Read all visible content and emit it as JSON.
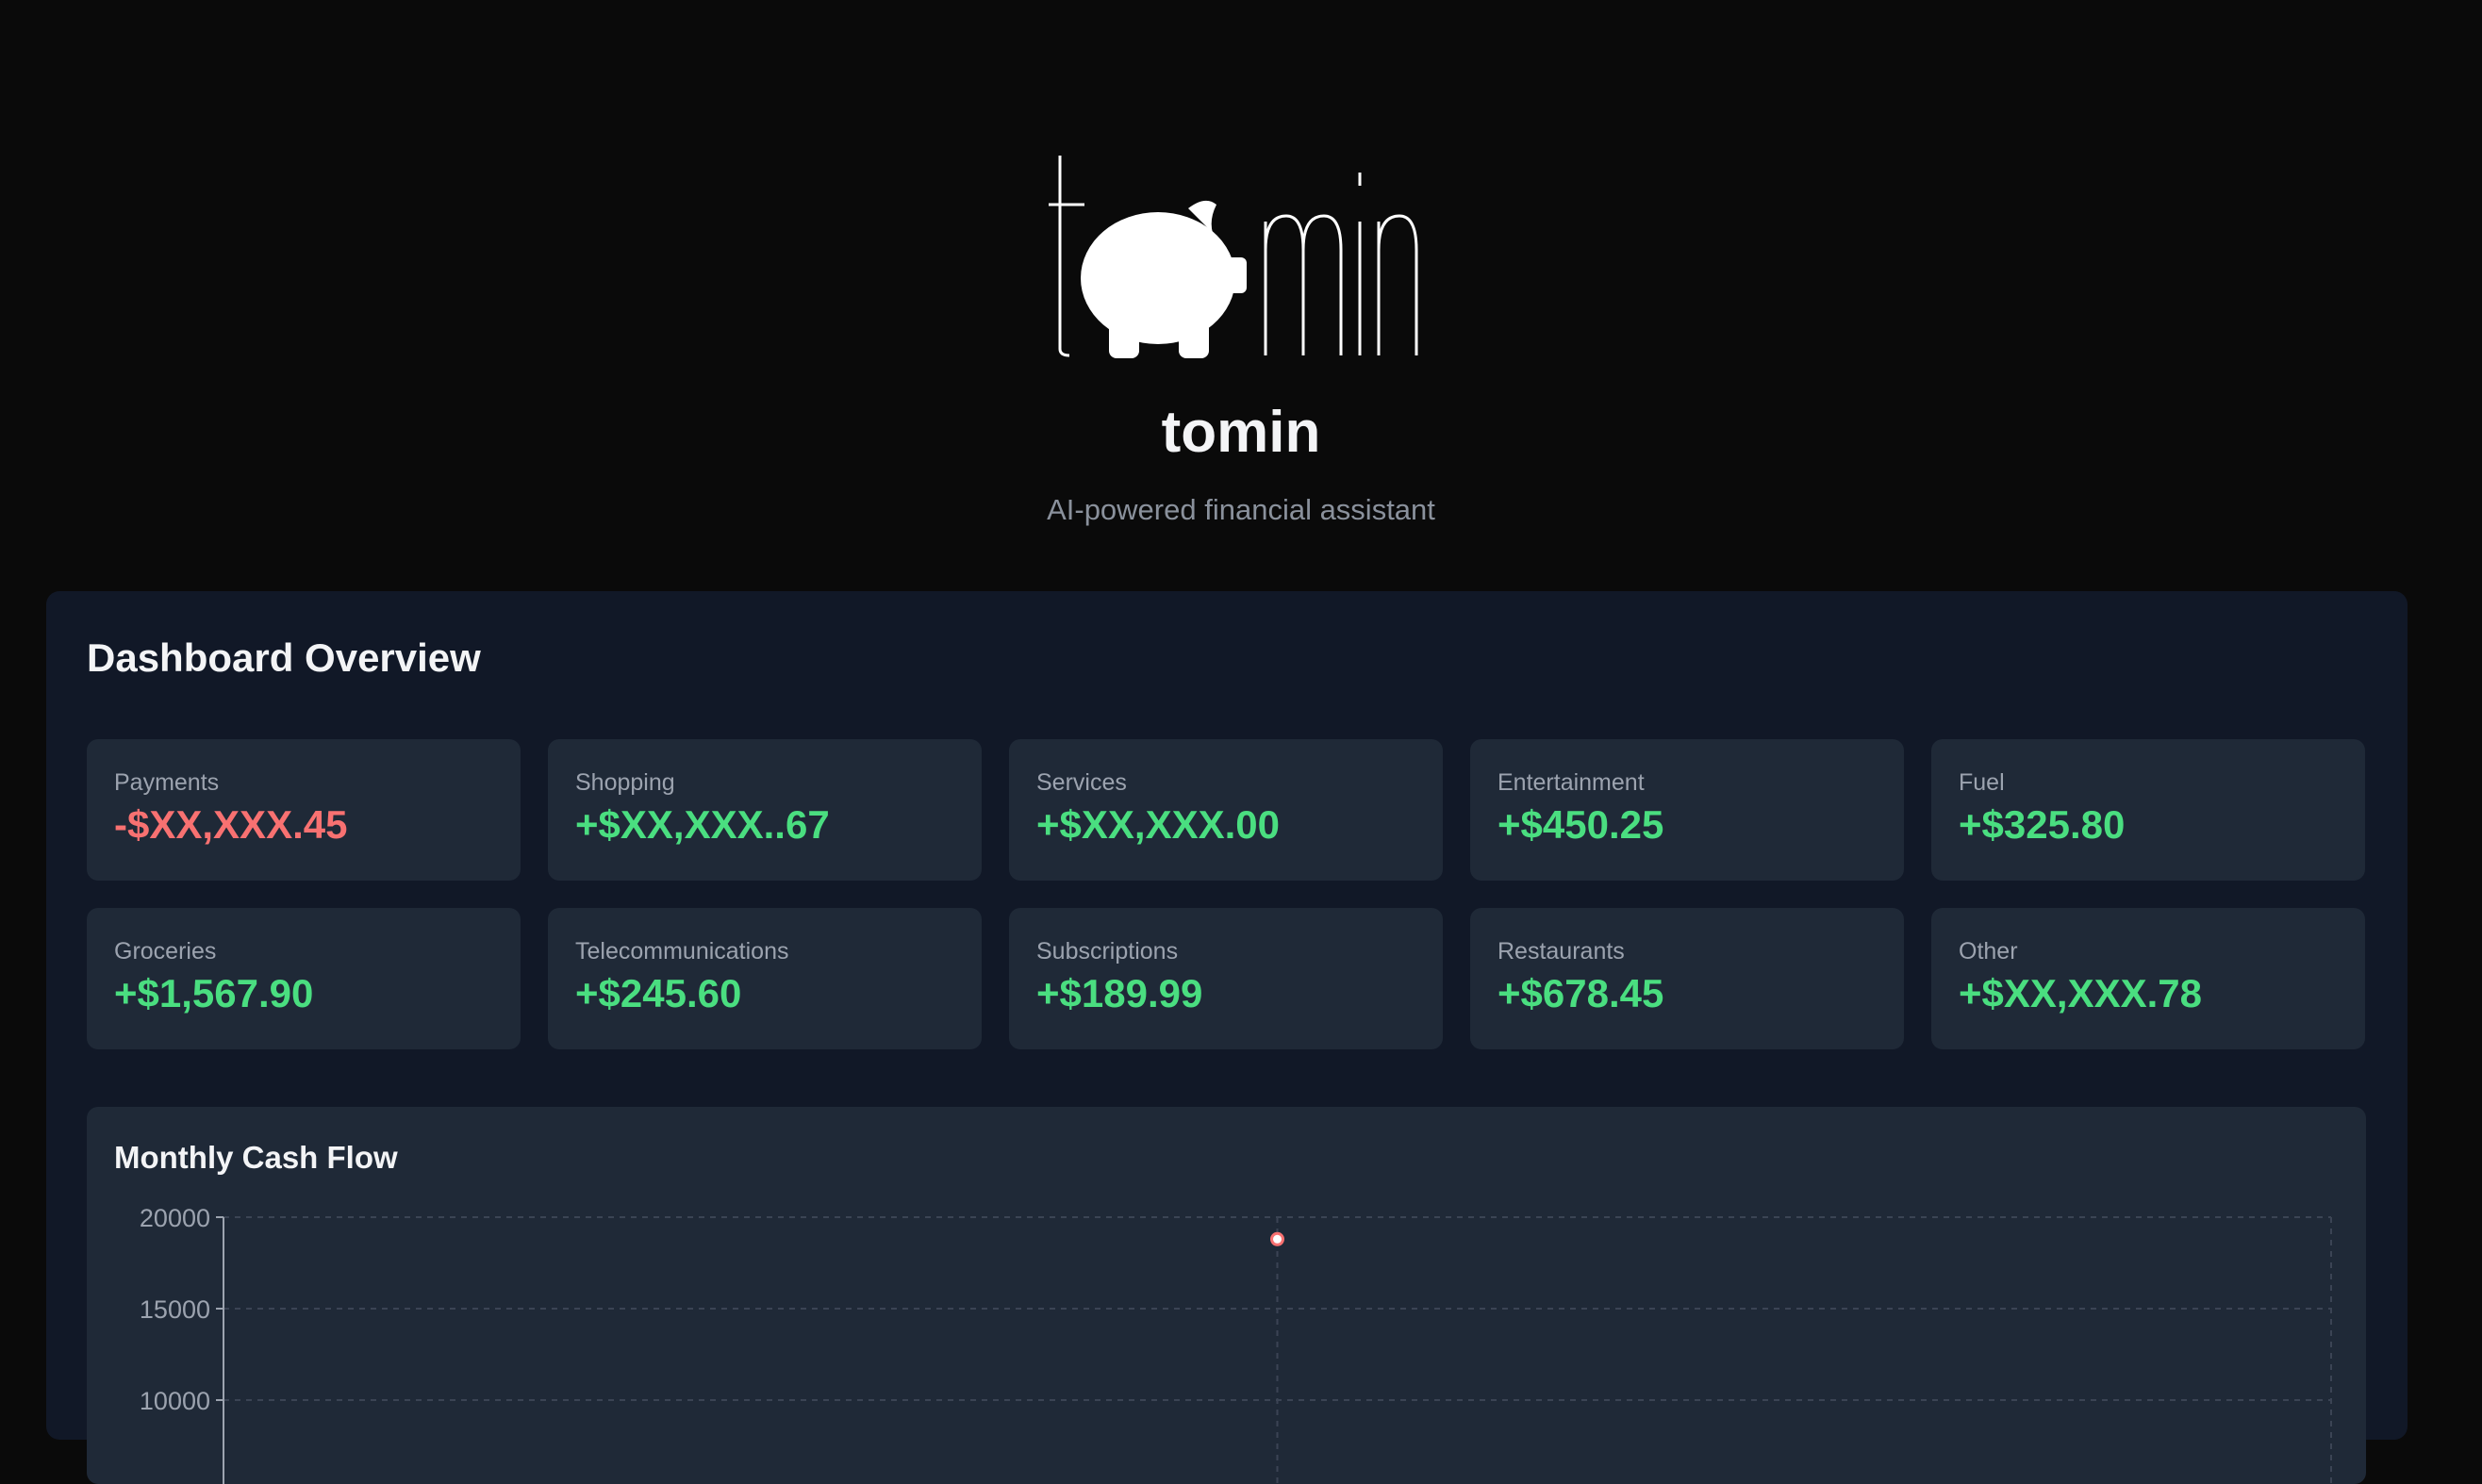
{
  "app": {
    "title": "tomin",
    "subtitle": "AI-powered financial assistant",
    "logo_text": "tomin"
  },
  "dashboard": {
    "title": "Dashboard Overview",
    "cards": [
      {
        "label": "Payments",
        "value": "-$XX,XXX.45",
        "sign": "negative"
      },
      {
        "label": "Shopping",
        "value": "+$XX,XXX..67",
        "sign": "positive"
      },
      {
        "label": "Services",
        "value": "+$XX,XXX.00",
        "sign": "positive"
      },
      {
        "label": "Entertainment",
        "value": "+$450.25",
        "sign": "positive"
      },
      {
        "label": "Fuel",
        "value": "+$325.80",
        "sign": "positive"
      },
      {
        "label": "Groceries",
        "value": "+$1,567.90",
        "sign": "positive"
      },
      {
        "label": "Telecommunications",
        "value": "+$245.60",
        "sign": "positive"
      },
      {
        "label": "Subscriptions",
        "value": "+$189.99",
        "sign": "positive"
      },
      {
        "label": "Restaurants",
        "value": "+$678.45",
        "sign": "positive"
      },
      {
        "label": "Other",
        "value": "+$XX,XXX.78",
        "sign": "positive"
      }
    ],
    "colors": {
      "positive": "#4ade80",
      "negative": "#f87171"
    }
  },
  "chart": {
    "title": "Monthly Cash Flow"
  },
  "chart_data": {
    "type": "line",
    "title": "Monthly Cash Flow",
    "xlabel": "",
    "ylabel": "",
    "y_ticks": [
      20000,
      15000,
      10000
    ],
    "ylim": [
      10000,
      20000
    ],
    "grid": true,
    "series": [
      {
        "color": "#f87171",
        "points": [
          {
            "x_index": 1,
            "y": 18800
          }
        ]
      }
    ],
    "x_count": 3
  }
}
